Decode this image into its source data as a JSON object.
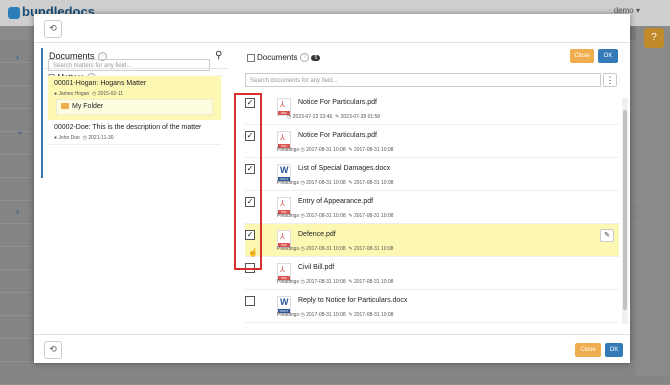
{
  "background": {
    "logo": "bundledocs",
    "user": "demo"
  },
  "modal": {
    "top_icon": "history-icon",
    "bottom_icon": "history-icon"
  },
  "left_panel": {
    "documents_label": "Documents",
    "matters_label": "Matters",
    "matter_search_placeholder": "Search matters for any field...",
    "matters": [
      {
        "title": "00001-Hogan: Hogans Matter",
        "user": "James Hogan",
        "date": "2015-02-11",
        "selected": true
      },
      {
        "title": "00002-Doe: This is the description of the matter",
        "user": "John Doe",
        "date": "2021-11-30",
        "selected": false
      }
    ],
    "folder_label": "My Folder"
  },
  "right_panel": {
    "documents_label": "Documents",
    "count": "5",
    "close_label": "Close",
    "ok_label": "OK",
    "doc_search_placeholder": "Search documents for any field...",
    "documents": [
      {
        "name": "Notice For Particulars.pdf",
        "type": "pdf",
        "tag": "",
        "created": "2023-07-22 23:46",
        "modified": "2023-07-28 01:58",
        "checked": true,
        "highlighted": false
      },
      {
        "name": "Notice For Particulars.pdf",
        "type": "pdf",
        "tag": "Pleadings",
        "created": "2017-08-31 10:08",
        "modified": "2017-08-31 10:08",
        "checked": true,
        "highlighted": false
      },
      {
        "name": "List of Special Damages.docx",
        "type": "word",
        "tag": "Pleadings",
        "created": "2017-08-31 10:08",
        "modified": "2017-08-31 10:08",
        "checked": true,
        "highlighted": false
      },
      {
        "name": "Entry of Appearance.pdf",
        "type": "pdf",
        "tag": "Pleadings",
        "created": "2017-08-31 10:08",
        "modified": "2017-08-31 10:08",
        "checked": true,
        "highlighted": false
      },
      {
        "name": "Defence.pdf",
        "type": "pdf",
        "tag": "Pleadings",
        "created": "2017-08-31 10:08",
        "modified": "2017-08-31 10:08",
        "checked": true,
        "highlighted": true
      },
      {
        "name": "Civil Bill.pdf",
        "type": "pdf",
        "tag": "Pleadings",
        "created": "2017-08-31 10:08",
        "modified": "2017-08-31 10:08",
        "checked": false,
        "highlighted": false
      },
      {
        "name": "Reply to Notice for Particulars.docx",
        "type": "word",
        "tag": "Pleadings",
        "created": "2017-08-31 10:08",
        "modified": "2017-08-31 10:08",
        "checked": false,
        "highlighted": false
      }
    ]
  },
  "footer": {
    "close_label": "Close",
    "ok_label": "OK"
  },
  "colors": {
    "accent": "#337ab7",
    "close": "#f0ad4e",
    "highlight": "#fcf8b3",
    "selection_box": "#d9302c"
  }
}
